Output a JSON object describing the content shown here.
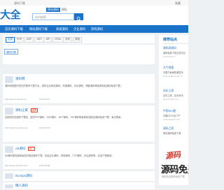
{
  "topbar": {
    "left_text": "源码下载",
    "right_text": "收藏"
  },
  "header": {
    "logo": "大全",
    "tabs": [
      {
        "label": "网站源码"
      },
      {
        "label": "网址"
      }
    ],
    "search_placeholder": "站内搜索"
  },
  "nav": {
    "items": [
      "首页源码下载",
      "网站源码下载",
      "商城源码",
      "企业源码",
      "游戏源码"
    ]
  },
  "filter": {
    "chips": [
      "全部",
      "PHP",
      "ASP",
      ".NET",
      "JSP",
      "HTML",
      "手机",
      "其他"
    ]
  },
  "view": {
    "toggle_label": "源码列表"
  },
  "items": [
    {
      "title": "源码网",
      "desc": "源码网是国内领先的源码下载平台，提供企业网站源码、商城源码、论坛源码、博客源码等各类网站源码免费下载。",
      "url": "http://www.example.cn/",
      "date": "2020-05-12"
    },
    {
      "title": "源码之家",
      "badge": "推荐",
      "desc": "全国领先的源码下载站，提供PHP源码、ASP源码、.NET源码、JSP源码等各种精品网站源码免费下载，每日更新。",
      "url": "http://www.mycodes.net/",
      "date": "2020-05-10"
    },
    {
      "title": "A5源码",
      "badge": "热门",
      "desc": "A5源码提供最新最全的网站源码下载，包括企业源码、商城源码、门户源码、论坛源码等，欢迎下载使用。",
      "url": "http://down.admin5.com/",
      "date": "2020-05-08"
    },
    {
      "title": "51Aspx源码",
      "desc": "51Aspx是专业的ASP.NET源码下载平台，提供各类.NET源码免费下载与交流分享。",
      "url": "http://www.51aspx.com/",
      "date": "2020-05-05"
    },
    {
      "title": "懒人源码",
      "desc": "",
      "url": "",
      "date": ""
    }
  ],
  "side": {
    "title": "推荐站点",
    "entries": [
      {
        "title": "源码网源码",
        "desc": "源码免费下载交流平台",
        "url": "www.code.cn"
      },
      {
        "title": "天气预报",
        "desc": "中国气象局权威发布",
        "url": "www.weather.com.cn"
      },
      {
        "title": "站长之家",
        "desc": "站长之家，站长资讯",
        "url": "www.chinaz.com"
      },
      {
        "title": "中国IDC圈",
        "desc": "中国IDC行业门户",
        "url": "www.idcquan.com"
      },
      {
        "title": "源码之家",
        "desc": "网站源码免费下载",
        "url": "www.mycodes.net"
      }
    ]
  },
  "promo": {
    "red_text": "源码",
    "black_text": "源码免费",
    "small_text": "海量精品源码免费下载"
  },
  "colors": {
    "primary": "#1a73c9",
    "accent": "#d63a2f",
    "page_bg": "#eef1f4"
  }
}
